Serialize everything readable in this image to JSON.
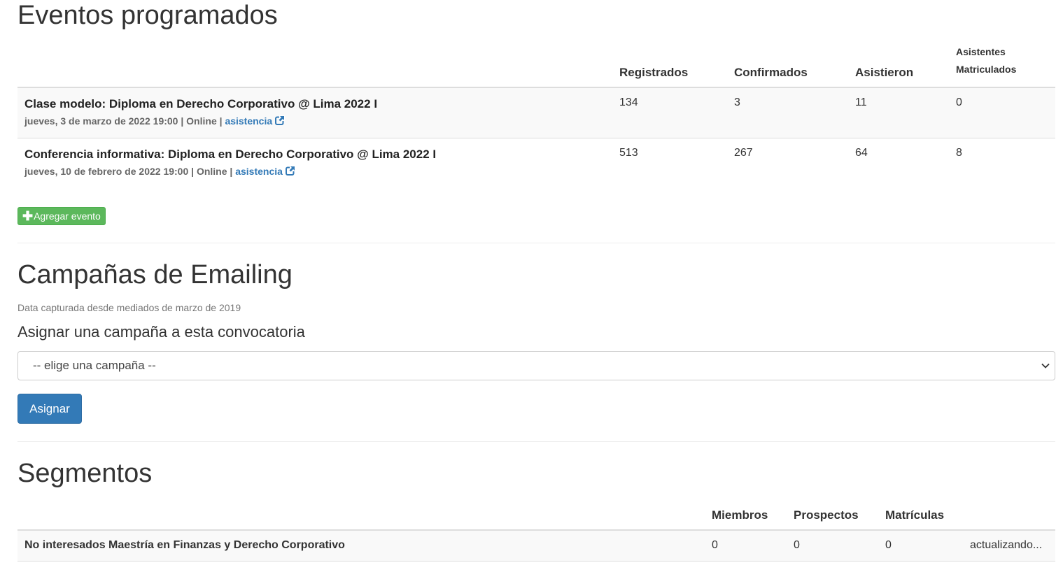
{
  "events": {
    "title": "Eventos programados",
    "columns": {
      "registered": "Registrados",
      "confirmed": "Confirmados",
      "attended": "Asistieron",
      "enrolled_line1": "Asistentes",
      "enrolled_line2": "Matriculados"
    },
    "rows": [
      {
        "name": "Clase modelo: Diploma en Derecho Corporativo @ Lima 2022 I",
        "date": "jueves, 3 de marzo de 2022 19:00",
        "mode": "Online",
        "link": "asistencia",
        "registered": "134",
        "confirmed": "3",
        "attended": "11",
        "enrolled": "0"
      },
      {
        "name": "Conferencia informativa: Diploma en Derecho Corporativo @ Lima 2022 I",
        "date": "jueves, 10 de febrero de 2022 19:00",
        "mode": "Online",
        "link": "asistencia",
        "registered": "513",
        "confirmed": "267",
        "attended": "64",
        "enrolled": "8"
      }
    ],
    "separator": "|",
    "add_button": "Agregar evento"
  },
  "campaigns": {
    "title": "Campañas de Emailing",
    "note": "Data capturada desde mediados de marzo de 2019",
    "assign_label": "Asignar una campaña a esta convocatoria",
    "select_value": "-- elige una campaña --",
    "assign_button": "Asignar"
  },
  "segments": {
    "title": "Segmentos",
    "columns": {
      "members": "Miembros",
      "prospects": "Prospectos",
      "enrollments": "Matrículas"
    },
    "rows": [
      {
        "name": "No interesados Maestría en Finanzas y Derecho Corporativo",
        "members": "0",
        "prospects": "0",
        "enrollments": "0",
        "status": "actualizando..."
      }
    ]
  },
  "colors": {
    "link": "#337ab7",
    "success": "#5cb85c",
    "primary": "#337ab7"
  },
  "icons": [
    "external-link-icon",
    "plus-icon",
    "chevron-down-icon"
  ]
}
